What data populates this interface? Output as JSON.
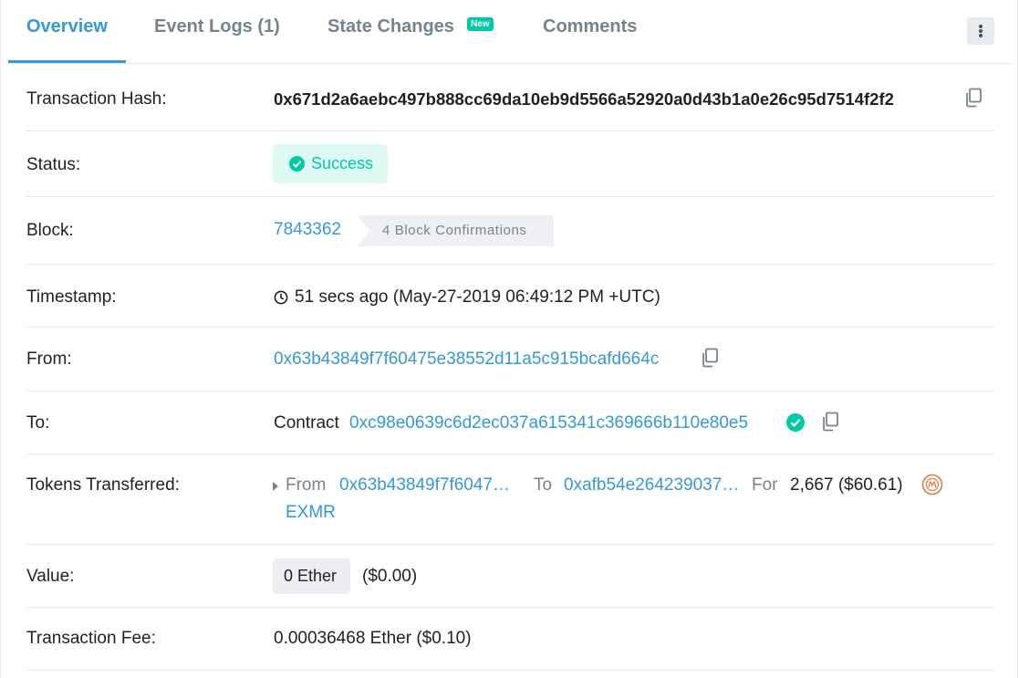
{
  "tabs": [
    {
      "label": "Overview"
    },
    {
      "label": "Event Logs (1)"
    },
    {
      "label": "State Changes",
      "badge": "New"
    },
    {
      "label": "Comments"
    }
  ],
  "rows": {
    "hash": {
      "label": "Transaction Hash:",
      "value": "0x671d2a6aebc497b888cc69da10eb9d5566a52920a0d43b1a0e26c95d7514f2f2"
    },
    "status": {
      "label": "Status:",
      "value": "Success"
    },
    "block": {
      "label": "Block:",
      "number": "7843362",
      "confirmations": "4 Block Confirmations"
    },
    "timestamp": {
      "label": "Timestamp:",
      "value": "51 secs ago (May-27-2019 06:49:12 PM +UTC)"
    },
    "from": {
      "label": "From:",
      "address": "0x63b43849f7f60475e38552d11a5c915bcafd664c"
    },
    "to": {
      "label": "To:",
      "prefix": "Contract",
      "address": "0xc98e0639c6d2ec037a615341c369666b110e80e5"
    },
    "tokens": {
      "label": "Tokens Transferred:",
      "from_label": "From",
      "from_address": "0x63b43849f7f6047…",
      "to_label": "To",
      "to_address": "0xafb54e264239037…",
      "for_label": "For",
      "amount": "2,667 ($60.61)",
      "token": "EXMR"
    },
    "value": {
      "label": "Value:",
      "amount": "0 Ether",
      "usd": "($0.00)"
    },
    "fee": {
      "label": "Transaction Fee:",
      "value": "0.00036468 Ether ($0.10)"
    }
  },
  "colors": {
    "accent": "#3498db",
    "success": "#00c9a7",
    "text": "#1e2022",
    "muted": "#77838f"
  }
}
